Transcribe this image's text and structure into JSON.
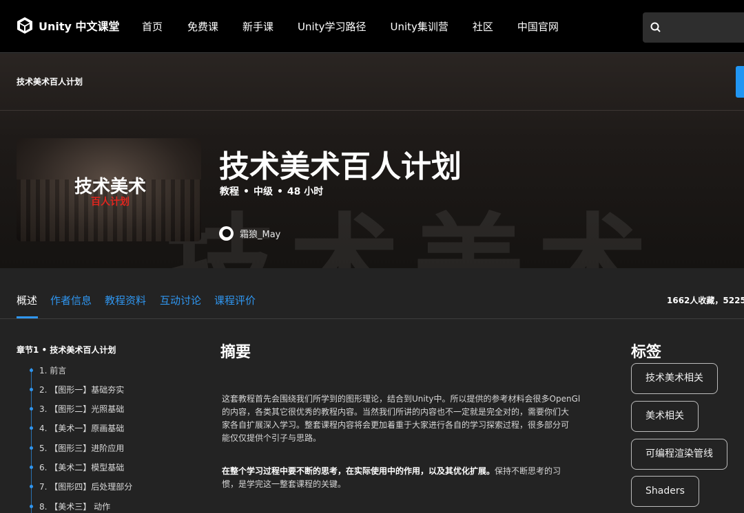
{
  "nav": {
    "logo_text": "Unity 中文课堂",
    "items": [
      "首页",
      "免费课",
      "新手课",
      "Unity学习路径",
      "Unity集训营",
      "社区",
      "中国官网"
    ],
    "search_placeholder": ""
  },
  "hero": {
    "breadcrumb": "技术美术百人计划",
    "thumbnail_title": "技术美术",
    "thumbnail_subtitle": "百人计划",
    "title": "技术美术百人计划",
    "meta": {
      "type": "教程",
      "level": "中级",
      "duration": "48 小时"
    },
    "author": "霜狼_May",
    "bg_glyphs": "技术美术"
  },
  "tabs": [
    "概述",
    "作者信息",
    "教程资料",
    "互动讨论",
    "课程评价"
  ],
  "stats_text": "1662人收藏，5225",
  "chapters": {
    "heading": "章节1 • 技术美术百人计划",
    "lessons": [
      "1. 前言",
      "2. 【图形一】基础夯实",
      "3. 【图形二】光照基础",
      "4. 【美术一】原画基础",
      "5. 【图形三】进阶应用",
      "6. 【美术二】模型基础",
      "7. 【图形四】后处理部分",
      "8. 【美术三】 动作"
    ]
  },
  "summary": {
    "title": "摘要",
    "p1_lines": [
      "这套教程首先会围绕我们所学到的图形理论，结合到Unity中。所以提供的参考材料会很多OpenGl",
      "的内容，各类其它很优秀的教程内容。当然我们所讲的内容也不一定就是完全对的，需要你们大",
      "家各自扩展深入学习。整套课程内容将会更加着重于大家进行各自的学习探索过程，很多部分可",
      "能仅仅提供个引子与思路。"
    ],
    "p2_bold": "在整个学习过程中要不断的思考，在实际使用中的作用，以及其优化扩展。",
    "p2_rest": "保持不断思考的习",
    "p2_line2": "惯，是学完这一整套课程的关键。"
  },
  "tags": {
    "title": "标签",
    "items": [
      "技术美术相关",
      "美术相关",
      "可编程渲染管线",
      "Shaders"
    ]
  }
}
